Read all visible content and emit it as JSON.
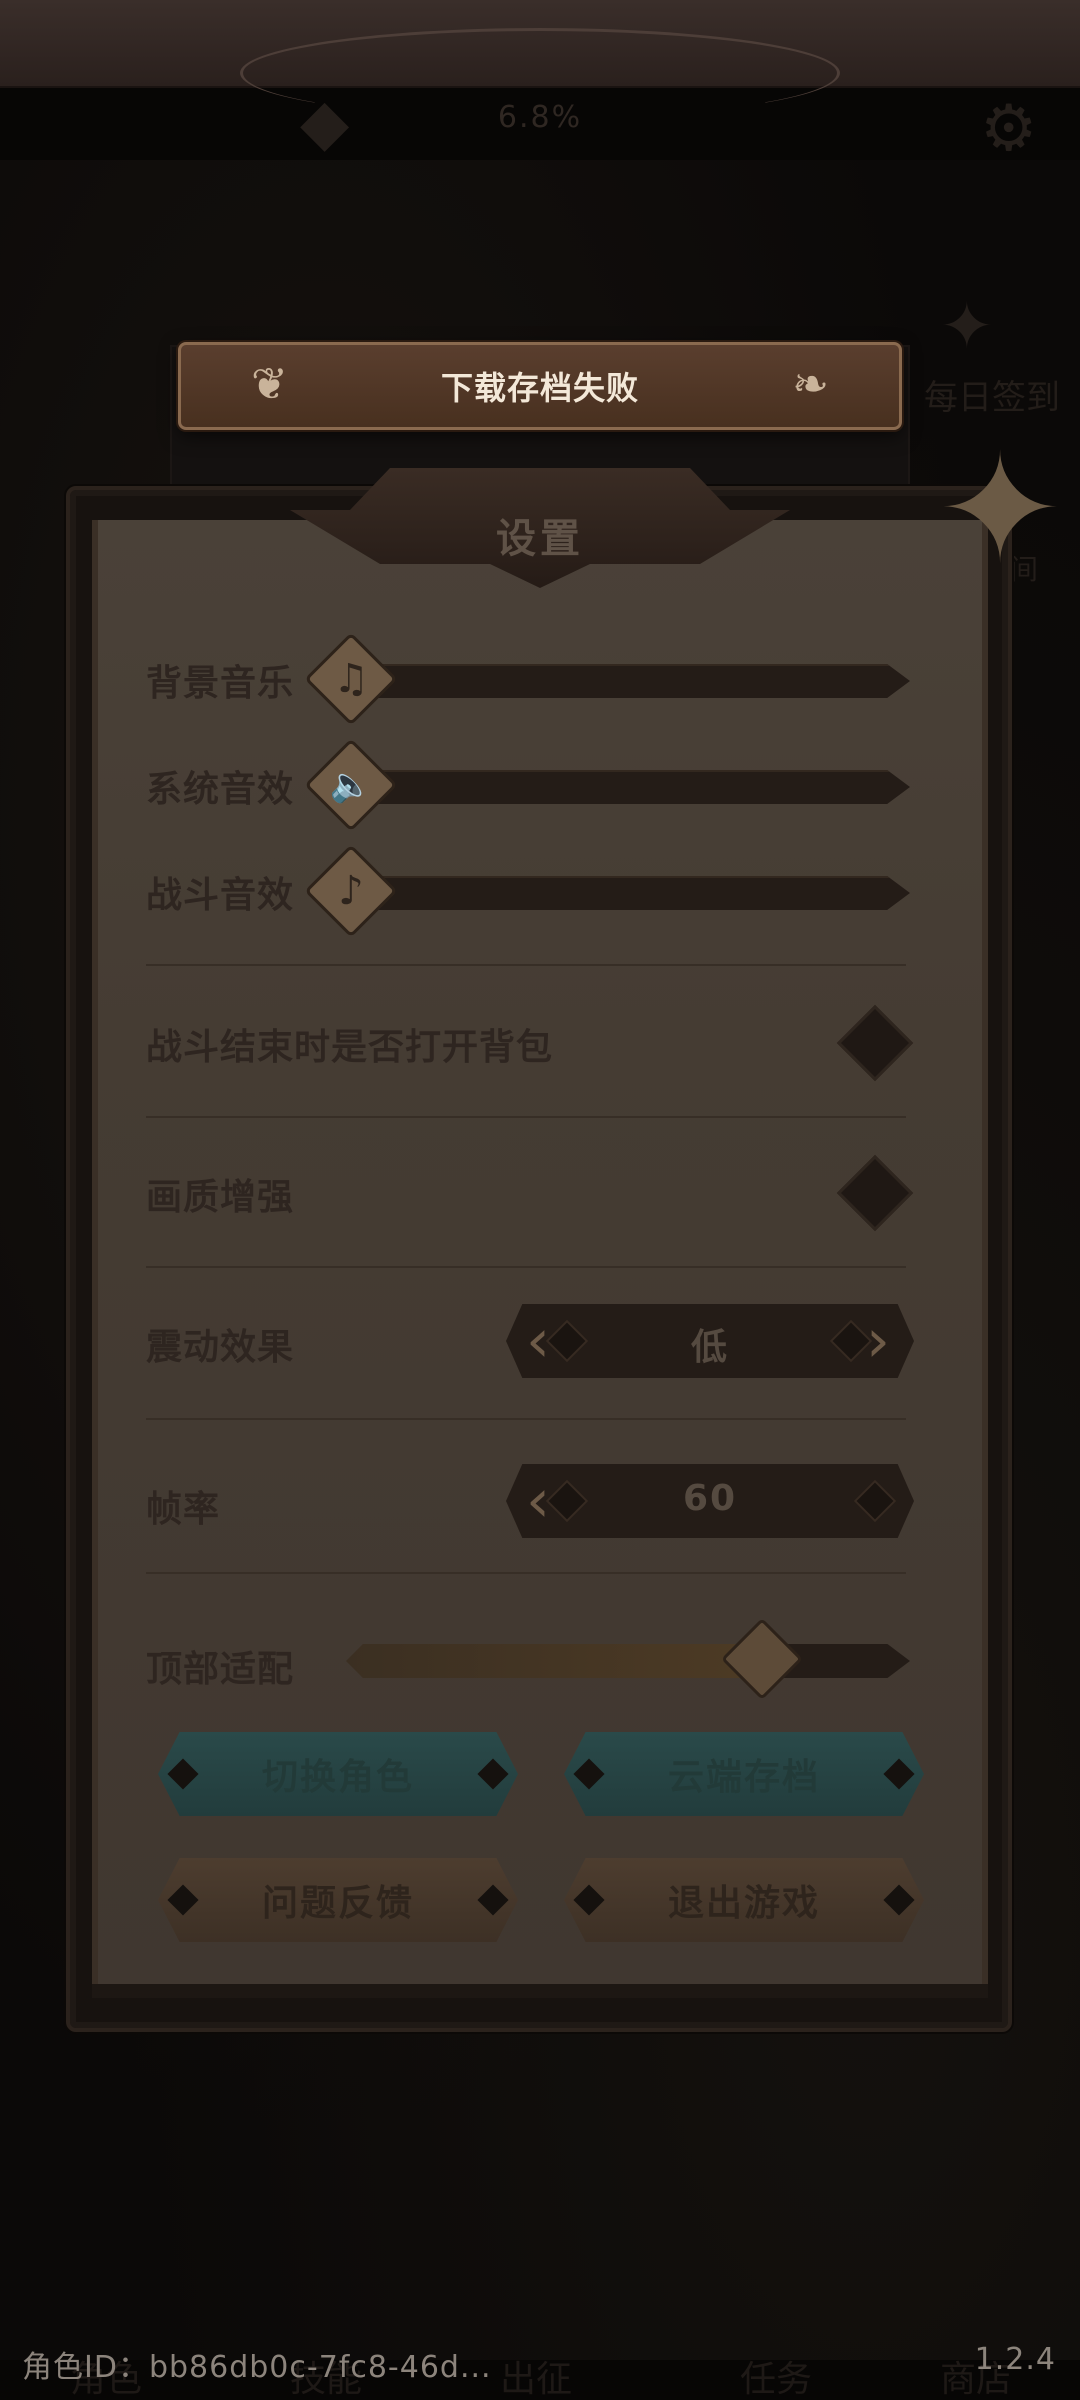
{
  "background": {
    "status_percent": "6.8%",
    "daily_checkin_label": "每日签到",
    "side_label": "间",
    "nav_items": [
      "角色",
      "技能",
      "出征",
      "任务",
      "商店"
    ]
  },
  "toast": {
    "message": "下载存档失败"
  },
  "settings": {
    "title": "设置",
    "volume": {
      "bgm_label": "背景音乐",
      "sfx_label": "系统音效",
      "battle_sfx_label": "战斗音效"
    },
    "open_bag_label": "战斗结束时是否打开背包",
    "graphics_enhance_label": "画质增强",
    "vibration": {
      "label": "震动效果",
      "value": "低"
    },
    "framerate": {
      "label": "帧率",
      "value": "60"
    },
    "top_adapt": {
      "label": "顶部适配",
      "level": 0.72
    },
    "buttons": {
      "switch_role": "切换角色",
      "cloud_save": "云端存档",
      "feedback": "问题反馈",
      "exit_game": "退出游戏"
    }
  },
  "footer": {
    "role_id": "角色ID：bb86db0c-7fc8-46d...",
    "version": "1.2.4"
  },
  "colors": {
    "accent_teal": "#2a4a4a",
    "toast_bg": "#5a3e2e",
    "panel_bg": "#4a4138"
  }
}
